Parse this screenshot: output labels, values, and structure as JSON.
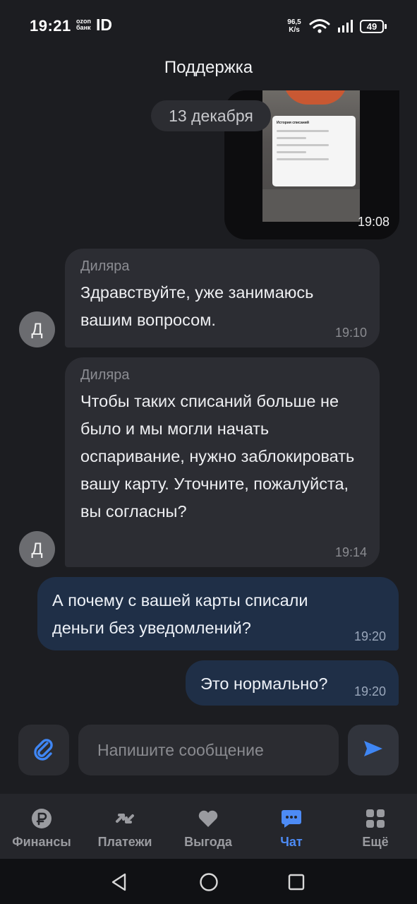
{
  "status": {
    "time": "19:21",
    "ozon_bank": "ozon банк",
    "id_mark": "ID",
    "net_speed": "96,5 K/s",
    "battery": "49"
  },
  "header": {
    "title": "Поддержка"
  },
  "chat": {
    "image_message": {
      "time": "19:08",
      "preview_heading": "История списаний"
    },
    "date_separator": "13 декабря",
    "messages": [
      {
        "direction": "in",
        "avatar": "Д",
        "sender": "Диляра",
        "text": "Здравствуйте, уже занимаюсь вашим вопросом.",
        "time": "19:10"
      },
      {
        "direction": "in",
        "avatar": "Д",
        "sender": "Диляра",
        "text": "Чтобы таких списаний больше не было и мы могли начать оспаривание, нужно заблокировать вашу карту. Уточните, пожалуйста, вы согласны?",
        "time": "19:14"
      },
      {
        "direction": "out",
        "text": "А почему с вашей карты списали деньги без уведомлений?",
        "time": "19:20"
      },
      {
        "direction": "out",
        "text": "Это нормально?",
        "time": "19:20"
      }
    ]
  },
  "composer": {
    "placeholder": "Напишите сообщение"
  },
  "nav": {
    "items": [
      {
        "label": "Финансы",
        "icon": "ruble-icon"
      },
      {
        "label": "Платежи",
        "icon": "transfer-arrows-icon"
      },
      {
        "label": "Выгода",
        "icon": "heart-icon"
      },
      {
        "label": "Чат",
        "icon": "chat-icon",
        "active": true
      },
      {
        "label": "Ещё",
        "icon": "grid-icon"
      }
    ]
  },
  "colors": {
    "accent": "#4d8bf5",
    "background": "#1c1d21",
    "bubble_in": "#2c2d33",
    "bubble_out": "#1f2f47"
  }
}
